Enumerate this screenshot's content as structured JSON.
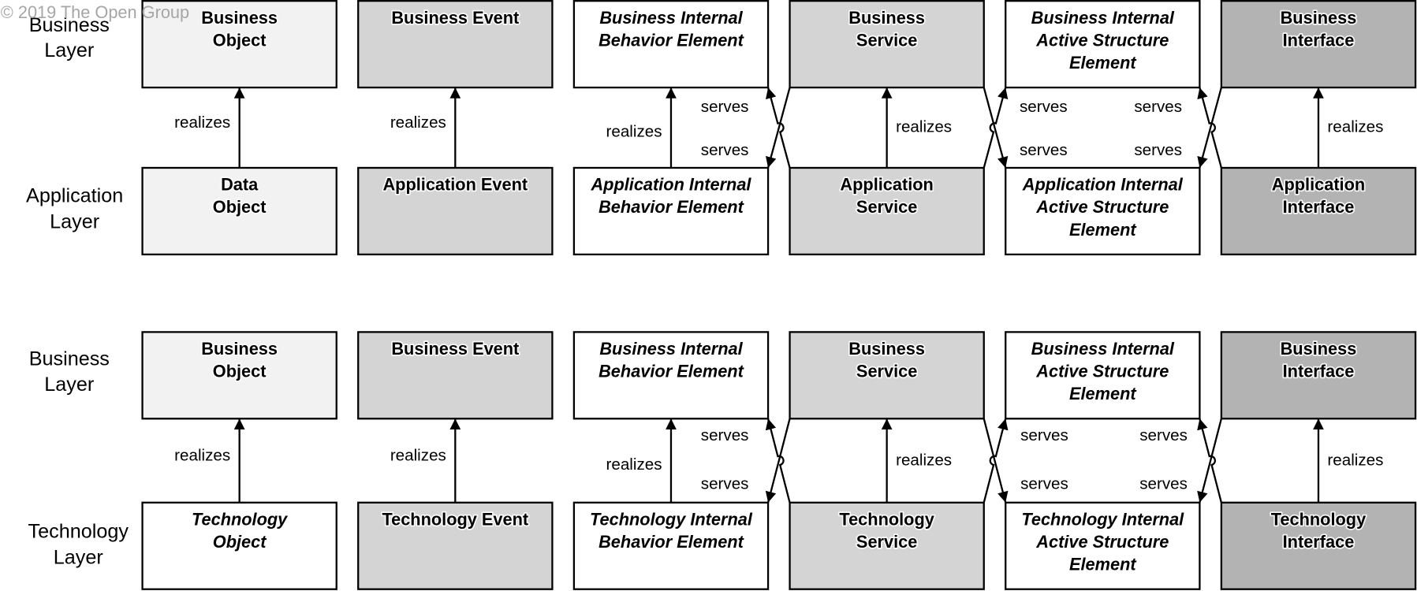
{
  "copyright": "© 2019 The Open Group",
  "colors": {
    "object": "#f2f2f2",
    "event": "#d4d4d4",
    "service": "#d4d4d4",
    "interface": "#b3b3b3",
    "internal": "#ffffff",
    "technology-object": "#ffffff",
    "border": "#000000"
  },
  "diagrams": [
    {
      "upper_layer": [
        "Business",
        "Layer"
      ],
      "lower_layer": [
        "Application",
        "Layer"
      ],
      "realizes_label": "realizes",
      "serves_label": "serves",
      "upper": [
        {
          "lines": [
            "Business",
            "Object"
          ],
          "italic": false,
          "kind": "object"
        },
        {
          "lines": [
            "Business Event"
          ],
          "italic": false,
          "kind": "event"
        },
        {
          "lines": [
            "Business Internal",
            "Behavior Element"
          ],
          "italic": true,
          "kind": "internal"
        },
        {
          "lines": [
            "Business",
            "Service"
          ],
          "italic": false,
          "kind": "service"
        },
        {
          "lines": [
            "Business Internal",
            "Active Structure",
            "Element"
          ],
          "italic": true,
          "kind": "internal"
        },
        {
          "lines": [
            "Business",
            "Interface"
          ],
          "italic": false,
          "kind": "interface"
        }
      ],
      "lower": [
        {
          "lines": [
            "Data",
            "Object"
          ],
          "italic": false,
          "kind": "object"
        },
        {
          "lines": [
            "Application Event"
          ],
          "italic": false,
          "kind": "event"
        },
        {
          "lines": [
            "Application Internal",
            "Behavior Element"
          ],
          "italic": true,
          "kind": "internal"
        },
        {
          "lines": [
            "Application",
            "Service"
          ],
          "italic": false,
          "kind": "service"
        },
        {
          "lines": [
            "Application Internal",
            "Active Structure",
            "Element"
          ],
          "italic": true,
          "kind": "internal"
        },
        {
          "lines": [
            "Application",
            "Interface"
          ],
          "italic": false,
          "kind": "interface"
        }
      ]
    },
    {
      "upper_layer": [
        "Business",
        "Layer"
      ],
      "lower_layer": [
        "Technology",
        "Layer"
      ],
      "realizes_label": "realizes",
      "serves_label": "serves",
      "upper": [
        {
          "lines": [
            "Business",
            "Object"
          ],
          "italic": false,
          "kind": "object"
        },
        {
          "lines": [
            "Business Event"
          ],
          "italic": false,
          "kind": "event"
        },
        {
          "lines": [
            "Business Internal",
            "Behavior Element"
          ],
          "italic": true,
          "kind": "internal"
        },
        {
          "lines": [
            "Business",
            "Service"
          ],
          "italic": false,
          "kind": "service"
        },
        {
          "lines": [
            "Business Internal",
            "Active Structure",
            "Element"
          ],
          "italic": true,
          "kind": "internal"
        },
        {
          "lines": [
            "Business",
            "Interface"
          ],
          "italic": false,
          "kind": "interface"
        }
      ],
      "lower": [
        {
          "lines": [
            "Technology",
            "Object"
          ],
          "italic": true,
          "kind": "technology-object"
        },
        {
          "lines": [
            "Technology Event"
          ],
          "italic": false,
          "kind": "event"
        },
        {
          "lines": [
            "Technology Internal",
            "Behavior Element"
          ],
          "italic": true,
          "kind": "internal"
        },
        {
          "lines": [
            "Technology",
            "Service"
          ],
          "italic": false,
          "kind": "service"
        },
        {
          "lines": [
            "Technology Internal",
            "Active Structure",
            "Element"
          ],
          "italic": true,
          "kind": "internal"
        },
        {
          "lines": [
            "Technology",
            "Interface"
          ],
          "italic": false,
          "kind": "interface"
        }
      ]
    }
  ]
}
